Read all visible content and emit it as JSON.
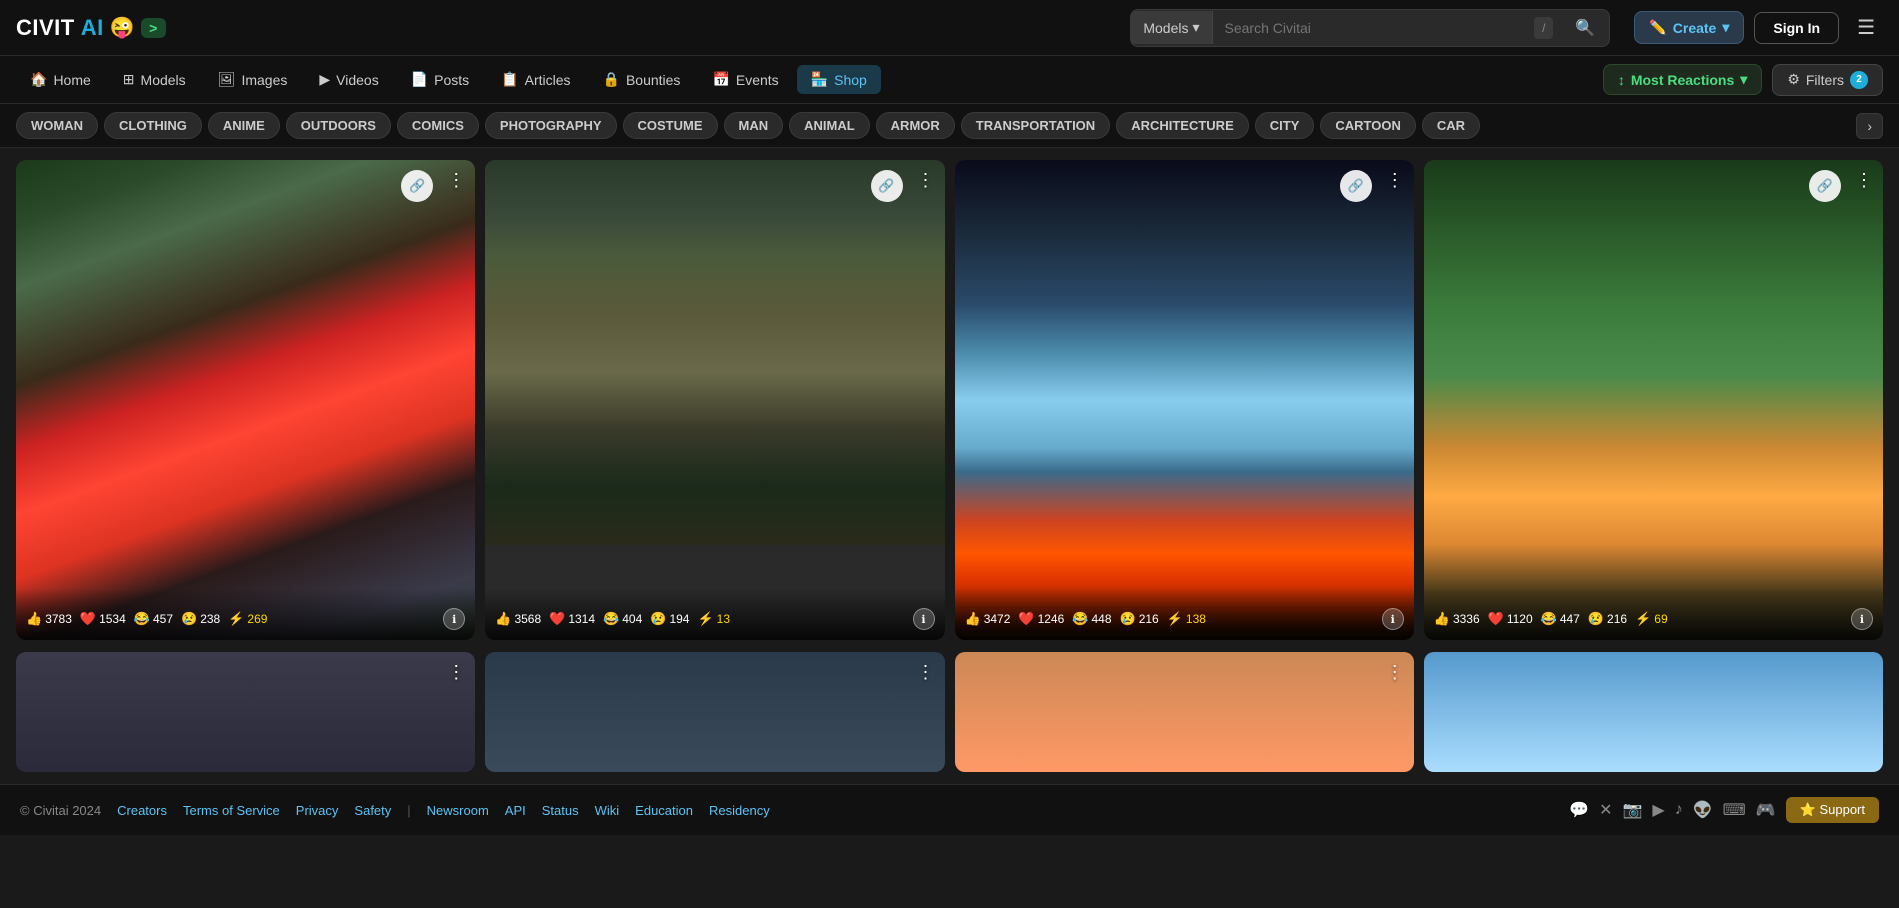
{
  "header": {
    "logo": {
      "civit": "CIVIT",
      "ai": "AI",
      "emoji": "😜",
      "arrow": ">"
    },
    "search": {
      "model_label": "Models",
      "placeholder": "Search Civitai",
      "slash": "/",
      "search_icon": "🔍"
    },
    "actions": {
      "create_label": "Create",
      "create_icon": "✏️",
      "signin_label": "Sign In",
      "menu_icon": "☰"
    }
  },
  "nav": {
    "items": [
      {
        "id": "home",
        "label": "Home",
        "icon": "🏠"
      },
      {
        "id": "models",
        "label": "Models",
        "icon": "⊞"
      },
      {
        "id": "images",
        "label": "Images",
        "icon": "🖼"
      },
      {
        "id": "videos",
        "label": "Videos",
        "icon": "▶"
      },
      {
        "id": "posts",
        "label": "Posts",
        "icon": "📄"
      },
      {
        "id": "articles",
        "label": "Articles",
        "icon": "📋"
      },
      {
        "id": "bounties",
        "label": "Bounties",
        "icon": "🔒"
      },
      {
        "id": "events",
        "label": "Events",
        "icon": "📅"
      },
      {
        "id": "shop",
        "label": "Shop",
        "icon": "🏪",
        "active": true
      }
    ],
    "sort": {
      "label": "Most Reactions",
      "icon": "↕"
    },
    "filter": {
      "label": "Filters",
      "badge": "2"
    }
  },
  "categories": [
    "WOMAN",
    "CLOTHING",
    "ANIME",
    "OUTDOORS",
    "COMICS",
    "PHOTOGRAPHY",
    "COSTUME",
    "MAN",
    "ANIMAL",
    "ARMOR",
    "TRANSPORTATION",
    "ARCHITECTURE",
    "CITY",
    "CARTOON",
    "CAR"
  ],
  "gallery": {
    "cards": [
      {
        "id": "card1",
        "stats": {
          "thumbs": "3783",
          "hearts": "1534",
          "laugh": "457",
          "sad": "238",
          "lightning": "269"
        }
      },
      {
        "id": "card2",
        "stats": {
          "thumbs": "3568",
          "hearts": "1314",
          "laugh": "404",
          "sad": "194",
          "lightning": "13"
        }
      },
      {
        "id": "card3",
        "stats": {
          "thumbs": "3472",
          "hearts": "1246",
          "laugh": "448",
          "sad": "216",
          "lightning": "138"
        }
      },
      {
        "id": "card4",
        "stats": {
          "thumbs": "3336",
          "hearts": "1120",
          "laugh": "447",
          "sad": "216",
          "lightning": "69"
        }
      }
    ]
  },
  "footer": {
    "copyright": "© Civitai 2024",
    "links": [
      "Creators",
      "Terms of Service",
      "Privacy",
      "Safety",
      "Newsroom",
      "API",
      "Status",
      "Wiki",
      "Education",
      "Residency"
    ],
    "support_label": "⭐ Support"
  },
  "icons": {
    "thumbs_up": "👍",
    "heart": "❤️",
    "laugh": "😂",
    "sad": "😢",
    "lightning": "⚡",
    "info": "ℹ",
    "link": "🔗",
    "dots": "⋮"
  }
}
